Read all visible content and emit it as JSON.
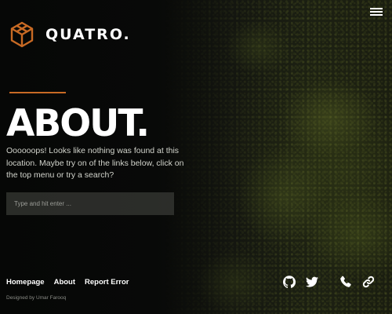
{
  "brand": {
    "name": "QUATRO.",
    "accent_color": "#c86a24",
    "logo_icon": "cube-logo-icon"
  },
  "header": {
    "menu_icon": "hamburger-menu-icon"
  },
  "main": {
    "title": "ABOUT.",
    "message": "Oooooops! Looks like nothing was found at this location. Maybe try on of the links below, click on the top menu or try a search?",
    "search": {
      "placeholder": "Type and hit enter ...",
      "value": ""
    }
  },
  "footer": {
    "links": [
      "Homepage",
      "About",
      "Report Error"
    ],
    "credit": "Designed by Umar Farooq",
    "social_icons": [
      "github-icon",
      "twitter-icon",
      "phone-icon",
      "link-icon"
    ]
  }
}
